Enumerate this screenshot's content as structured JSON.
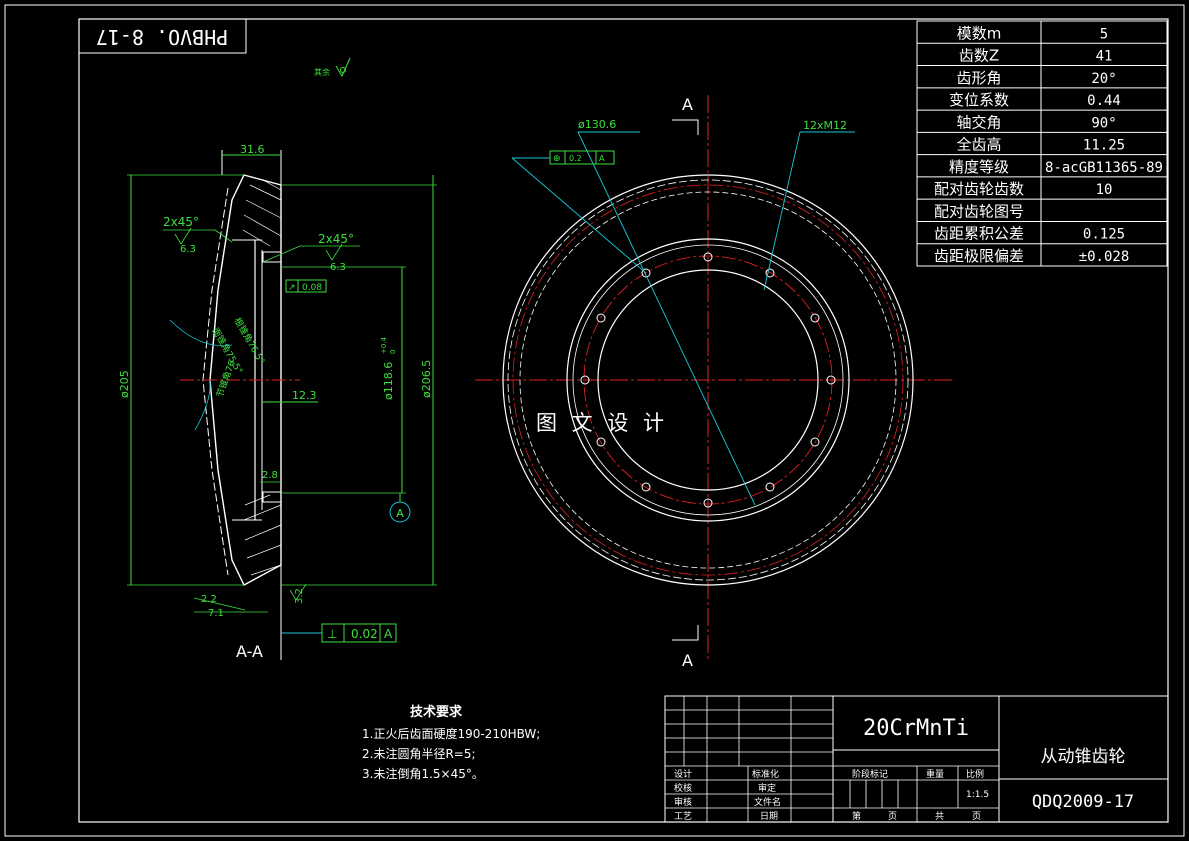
{
  "frame": {
    "stamp": "PHBVO. 8-17",
    "note_left": "其余",
    "watermark": "图 文 设 计"
  },
  "section_view": {
    "label": "A-A",
    "dims": {
      "width_top": "31.6",
      "dia_205": "ø205",
      "dia_118": "ø118.6",
      "dia_118_tol": "+0.4",
      "dia_118_tol_low": "0",
      "dia_206": "ø206.5",
      "len_12_3": "12.3",
      "chamfer1": "2x45°",
      "chamfer2": "2x45°",
      "rough1": "6.3",
      "rough2": "6.3",
      "rough3": "3.2",
      "runout": "0.08",
      "bottom_2_2": "2.2",
      "bottom_7_1": "7.1",
      "small_2_8": "2.8",
      "angle1": "根锥角76.5°",
      "angle2": "面锥角75.5°",
      "angle3": "节锥角76",
      "perp_tol": "0.02",
      "perp_datum": "A",
      "datum": "A"
    }
  },
  "front_view": {
    "section_mark_top": "A",
    "section_mark_bottom": "A",
    "bolt_circle": "ø130.6",
    "holes": "12xM12",
    "pos_tol": "0.2",
    "pos_datum": "A"
  },
  "param_table": {
    "rows": [
      {
        "name": "模数m",
        "value": "5"
      },
      {
        "name": "齿数Z",
        "value": "41"
      },
      {
        "name": "齿形角",
        "value": "20°"
      },
      {
        "name": "变位系数",
        "value": "0.44"
      },
      {
        "name": "轴交角",
        "value": "90°"
      },
      {
        "name": "全齿高",
        "value": "11.25"
      },
      {
        "name": "精度等级",
        "value": "8-acGB11365-89"
      },
      {
        "name": "配对齿轮齿数",
        "value": "10"
      },
      {
        "name": "配对齿轮图号",
        "value": ""
      },
      {
        "name": "齿距累积公差",
        "value": "0.125"
      },
      {
        "name": "齿距极限偏差",
        "value": "±0.028"
      }
    ]
  },
  "requirements": {
    "title": "技术要求",
    "items": [
      "1.正火后齿面硬度190-210HBW;",
      "2.未注圆角半径R=5;",
      "3.未注倒角1.5×45°。"
    ]
  },
  "title_block": {
    "material": "20CrMnTi",
    "part_name": "从动锥齿轮",
    "drawing_no": "QDQ2009-17",
    "roles": [
      "设计",
      "校核",
      "审核",
      "工艺"
    ],
    "roles2": [
      "标准化",
      "审定",
      "文件名",
      "日期"
    ],
    "stage_label": "阶段标记",
    "weight_label": "重量",
    "scale_label": "比例",
    "scale": "1:1.5",
    "sheet_label": "第",
    "page_label": "页",
    "total_label": "共",
    "page2_label": "页"
  },
  "colors": {
    "background": "#000000",
    "line": "#ffffff",
    "dimension": "#3be03b",
    "leader": "#17c8d8",
    "centerline": "#e02020"
  }
}
